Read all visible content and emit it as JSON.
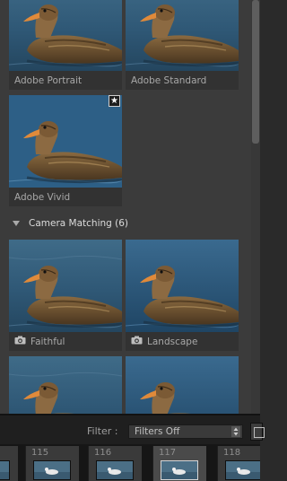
{
  "profiles": {
    "adobe_group": [
      {
        "name": "Adobe Portrait",
        "favorite": false,
        "camera_icon": false
      },
      {
        "name": "Adobe Standard",
        "favorite": false,
        "camera_icon": false
      },
      {
        "name": "Adobe Vivid",
        "favorite": true,
        "camera_icon": false
      }
    ],
    "camera_matching": {
      "label": "Camera Matching (6)",
      "items": [
        {
          "name": "Faithful",
          "camera_icon": true
        },
        {
          "name": "Landscape",
          "camera_icon": true
        },
        {
          "name": "",
          "camera_icon": false
        },
        {
          "name": "",
          "camera_icon": false
        }
      ]
    },
    "favorite_icon": "star-icon",
    "camera_icon": "camera-icon",
    "expand_icon": "triangle-down-icon"
  },
  "filter": {
    "label": "Filter :",
    "value": "Filters Off"
  },
  "filmstrip": {
    "frames": [
      {
        "number": "",
        "selected": false
      },
      {
        "number": "115",
        "selected": false
      },
      {
        "number": "116",
        "selected": false
      },
      {
        "number": "117",
        "selected": true
      },
      {
        "number": "118",
        "selected": false
      }
    ]
  },
  "colors": {
    "panel_bg": "#3b3b3b",
    "tile_caption_bg": "#323232",
    "caption_text": "#a8a8a8",
    "filmstrip_bg": "#161616"
  }
}
